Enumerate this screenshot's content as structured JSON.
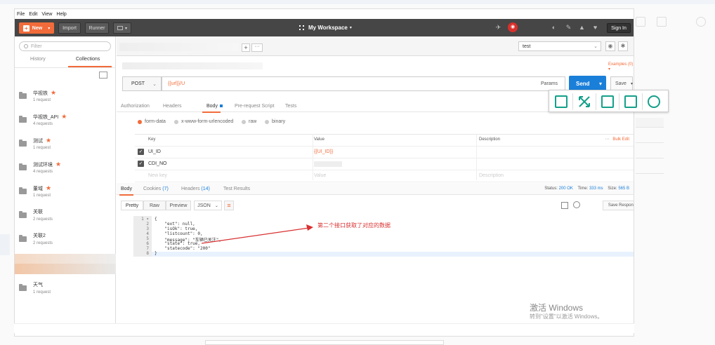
{
  "menu": [
    "File",
    "Edit",
    "View",
    "Help"
  ],
  "header": {
    "new_label": "New",
    "import_label": "Import",
    "runner_label": "Runner",
    "workspace_label": "My Workspace",
    "sync_label": "",
    "signin_label": "Sign In"
  },
  "sidebar": {
    "filter_placeholder": "Filter",
    "tab_history": "History",
    "tab_collections": "Collections",
    "collections": [
      {
        "name": "华视铁",
        "starred": true,
        "count": "1 request"
      },
      {
        "name": "华视铁_API",
        "starred": true,
        "count": "4 requests"
      },
      {
        "name": "测试",
        "starred": true,
        "count": "1 request"
      },
      {
        "name": "测试环境",
        "starred": true,
        "count": "4 requests"
      },
      {
        "name": "董域",
        "starred": true,
        "count": "1 request"
      },
      {
        "name": "关联",
        "starred": false,
        "count": "2 requests"
      },
      {
        "name": "关联2",
        "starred": false,
        "count": "2 requests"
      },
      {
        "name": "天气",
        "starred": false,
        "count": "1 request"
      }
    ]
  },
  "environment": {
    "selected": "test"
  },
  "request": {
    "examples_label": "Examples (0) ▾",
    "method": "POST",
    "url": "{{url}}/U",
    "params_label": "Params",
    "send_label": "Send",
    "save_label": "Save",
    "tabs": [
      "Authorization",
      "Headers",
      "Body",
      "Pre-request Script",
      "Tests"
    ],
    "body_modes": [
      "form-data",
      "x-www-form-urlencoded",
      "raw",
      "binary"
    ],
    "table_headers": {
      "key": "Key",
      "value": "Value",
      "description": "Description",
      "bulk": "Bulk Edit"
    },
    "rows": [
      {
        "key": "UI_ID",
        "value": "{{UI_ID}}",
        "checked": true
      },
      {
        "key": "CDI_NO",
        "value": "",
        "checked": true
      }
    ],
    "placeholder": {
      "key": "New key",
      "value": "Value",
      "description": "Description"
    }
  },
  "response": {
    "tabs": {
      "body": "Body",
      "cookies": "Cookies",
      "cookies_count": "(7)",
      "headers": "Headers",
      "headers_count": "(14)",
      "tests": "Test Results"
    },
    "status_label": "Status:",
    "status_value": "200 OK",
    "time_label": "Time:",
    "time_value": "333 ms",
    "size_label": "Size:",
    "size_value": "565 B",
    "formats": {
      "pretty": "Pretty",
      "raw": "Raw",
      "preview": "Preview",
      "type": "JSON"
    },
    "save_response": "Save Response",
    "code_lines": [
      "{",
      "    \"ext\": null,",
      "    \"isOk\": true,",
      "    \"listcount\": 0,",
      "    \"message\": \"车辆已关注\",",
      "    \"state\": true,",
      "    \"statecode\": \"200\"",
      "}"
    ]
  },
  "annotation": "第二个接口获取了对应的数据",
  "watermark": {
    "line1": "激活 Windows",
    "line2": "转到\"设置\"以激活 Windows。"
  },
  "colors": {
    "accent": "#f26b3a",
    "send": "#1a7fd9",
    "header": "#464646",
    "toolbar_icon": "#13a08a"
  }
}
